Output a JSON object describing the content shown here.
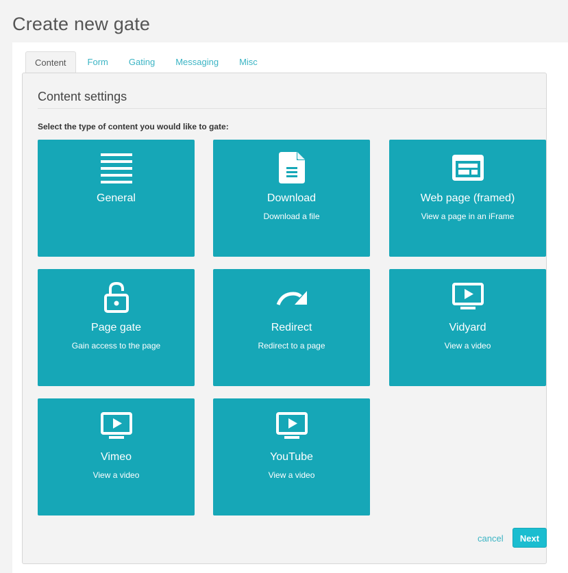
{
  "page": {
    "title": "Create new gate"
  },
  "tabs": [
    {
      "label": "Content",
      "active": true
    },
    {
      "label": "Form",
      "active": false
    },
    {
      "label": "Gating",
      "active": false
    },
    {
      "label": "Messaging",
      "active": false
    },
    {
      "label": "Misc",
      "active": false
    }
  ],
  "content_settings": {
    "heading": "Content settings",
    "instruction": "Select the type of content you would like to gate:",
    "tiles": [
      {
        "icon": "list-icon",
        "title": "General",
        "subtitle": ""
      },
      {
        "icon": "document-icon",
        "title": "Download",
        "subtitle": "Download a file"
      },
      {
        "icon": "browser-window-icon",
        "title": "Web page (framed)",
        "subtitle": "View a page in an iFrame"
      },
      {
        "icon": "unlock-icon",
        "title": "Page gate",
        "subtitle": "Gain access to the page"
      },
      {
        "icon": "redirect-arrow-icon",
        "title": "Redirect",
        "subtitle": "Redirect to a page"
      },
      {
        "icon": "video-monitor-icon",
        "title": "Vidyard",
        "subtitle": "View a video"
      },
      {
        "icon": "video-monitor-icon",
        "title": "Vimeo",
        "subtitle": "View a video"
      },
      {
        "icon": "video-monitor-icon",
        "title": "YouTube",
        "subtitle": "View a video"
      }
    ]
  },
  "actions": {
    "cancel_label": "cancel",
    "next_label": "Next"
  },
  "colors": {
    "tile": "#16a7b7",
    "accent": "#3bb4c4",
    "next_button": "#1bbdd0"
  }
}
